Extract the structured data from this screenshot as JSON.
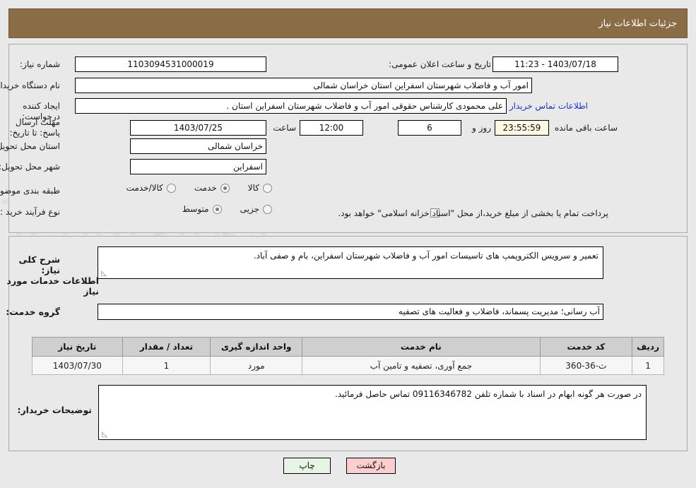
{
  "header": {
    "title": "جزئیات اطلاعات نیاز"
  },
  "form": {
    "need_number_label": "شماره نیاز:",
    "need_number_value": "1103094531000019",
    "announce_label": "تاریخ و ساعت اعلان عمومی:",
    "announce_value": "1403/07/18 - 11:23",
    "buyer_org_label": "نام دستگاه خریدار:",
    "buyer_org_value": "امور آب و فاضلاب شهرستان اسفراین استان خراسان شمالی",
    "creator_label": "ایجاد کننده درخواست:",
    "creator_value": "علی  محمودی  کارشناس حقوقی امور آب و فاضلاب شهرستان اسفراین استان .",
    "creator_link": "اطلاعات تماس خریدار",
    "deadline_label": "مهلت ارسال پاسخ: تا تاریخ:",
    "deadline_date": "1403/07/25",
    "deadline_hour_label": "ساعت",
    "deadline_hour_value": "12:00",
    "remaining_days": "6",
    "remaining_days_label": "روز و",
    "remaining_time": "23:55:59",
    "remaining_suffix": "ساعت باقی مانده",
    "province_label": "استان محل تحویل:",
    "province_value": "خراسان شمالی",
    "city_label": "شهر محل تحویل:",
    "city_value": "اسفراین",
    "category_label": "طبقه بندی موضوعی:",
    "category_options": [
      {
        "label": "کالا",
        "selected": false
      },
      {
        "label": "خدمت",
        "selected": true
      },
      {
        "label": "کالا/خدمت",
        "selected": false
      }
    ],
    "process_label": "نوع فرآیند خرید :",
    "process_options": [
      {
        "label": "جزیی",
        "selected": false
      },
      {
        "label": "متوسط",
        "selected": true
      }
    ],
    "treasury_checkbox_text": "پرداخت تمام یا بخشی از مبلغ خرید،از محل \"اسناد خزانه اسلامی\" خواهد بود."
  },
  "description": {
    "label": "شرح کلی نیاز:",
    "value": "تعمیر و سرویس الکتروپمپ های تاسیسات امور آب و فاضلاب شهرستان اسفراین، بام و صفی آباد."
  },
  "services_section": {
    "heading": "اطلاعات خدمات مورد نیاز",
    "group_label": "گروه خدمت:",
    "group_value": "آب رسانی؛ مدیریت پسماند، فاضلاب و فعالیت های تصفیه"
  },
  "table": {
    "columns": [
      "ردیف",
      "کد خدمت",
      "نام خدمت",
      "واحد اندازه گیری",
      "تعداد / مقدار",
      "تاریخ نیاز"
    ],
    "rows": [
      {
        "row": "1",
        "code": "ث-36-360",
        "name": "جمع آوری، تصفیه و تامین آب",
        "unit": "مورد",
        "qty": "1",
        "date": "1403/07/30"
      }
    ]
  },
  "buyer_notes": {
    "label": "توضیحات خریدار:",
    "value": "در صورت هر گونه ابهام در اسناد با شماره تلفن 09116346782 تماس حاصل فرمائید."
  },
  "buttons": {
    "print": "چاپ",
    "back": "بازگشت"
  },
  "watermark": {
    "text": "AriaTender.net"
  },
  "colors": {
    "header_bar": "#8a6d46",
    "link": "#1b35c8",
    "print_btn": "#e7f6e4",
    "back_btn": "#fbcfcf",
    "panel_bg": "#e9e9e9"
  }
}
